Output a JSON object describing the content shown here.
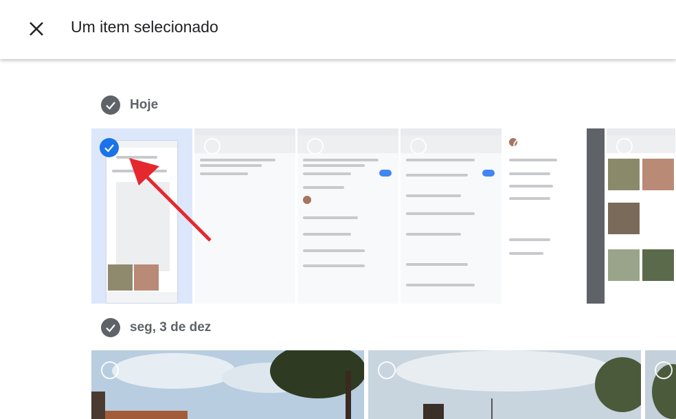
{
  "header": {
    "title": "Um item selecionado",
    "close_icon": "close-icon"
  },
  "sections": [
    {
      "label": "Hoje",
      "icon": "check-circle-icon"
    },
    {
      "label": "seg, 3 de dez",
      "icon": "check-circle-icon"
    }
  ],
  "colors": {
    "accent": "#1a73e8",
    "selected_bg": "#dde7fb",
    "arrow": "#e5282e"
  }
}
